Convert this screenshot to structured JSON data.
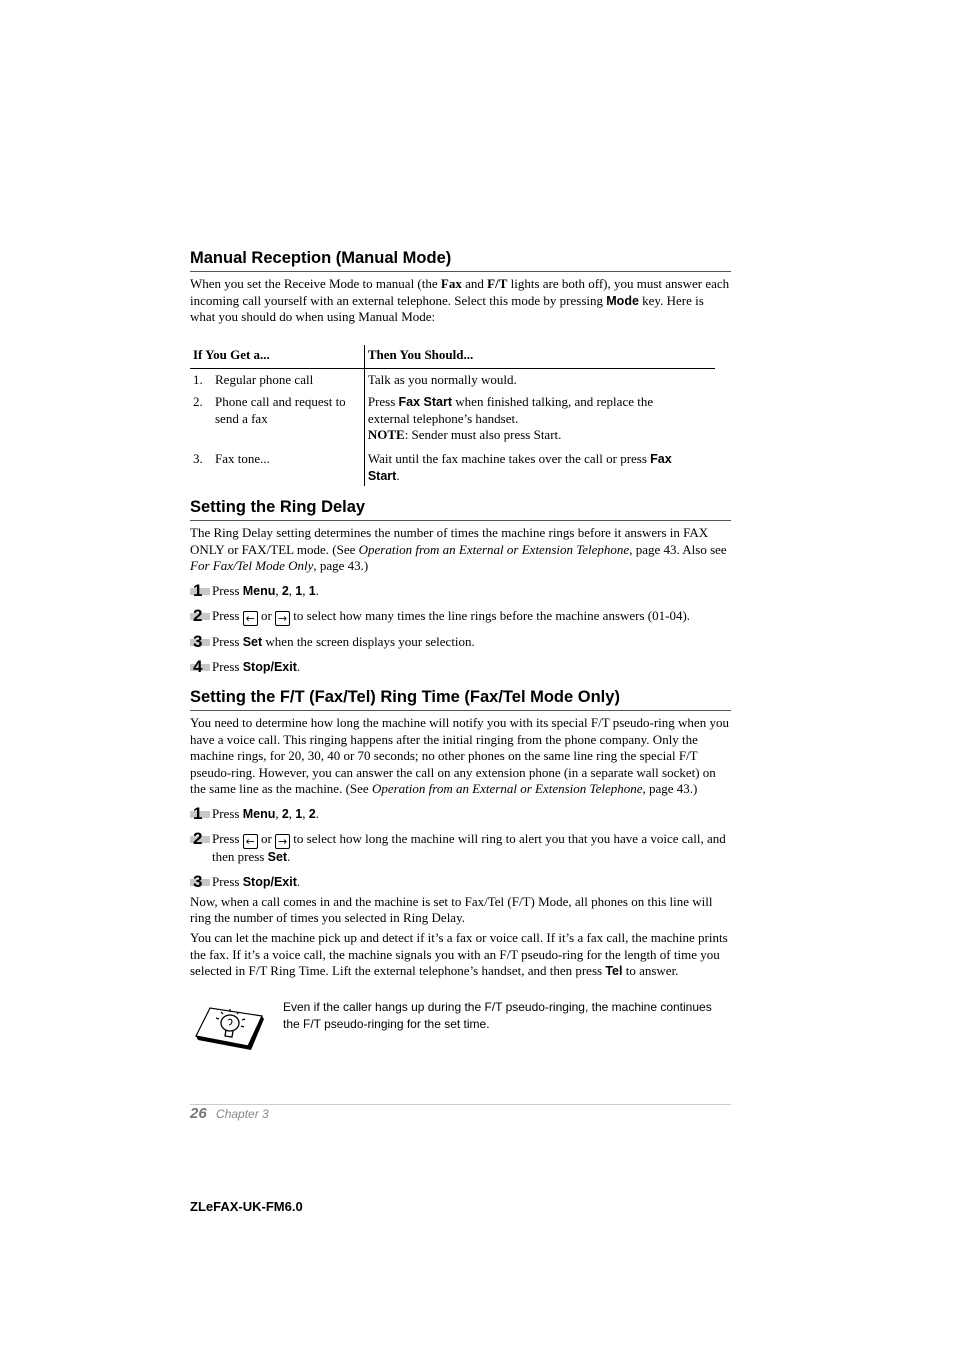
{
  "sections": {
    "manual": {
      "title": "Manual Reception (Manual Mode)",
      "intro": {
        "t1": "When you set the Receive Mode to manual (the ",
        "b1": "Fax",
        "t2": " and ",
        "b2": "F/T",
        "t3": " lights are both off), you must answer each incoming call yourself with an external telephone. Select this mode by pressing ",
        "b3": "Mode",
        "t4": " key. Here is what you should do when using Manual Mode:"
      },
      "table": {
        "headers": [
          "If You Get a...",
          "Then You Should..."
        ],
        "rows": [
          {
            "num": "1.",
            "get": "Regular phone call",
            "should": "Talk as you normally would."
          },
          {
            "num": "2.",
            "get": "Phone call and request to send a fax",
            "should_pre": "Press ",
            "should_bold": "Fax Start",
            "should_post": " when finished talking, and replace the external telephone’s handset.",
            "note_label": "NOTE",
            "note_text": ": Sender must also press Start."
          },
          {
            "num": "3.",
            "get": "Fax tone...",
            "should_pre": "Wait until the fax machine takes over the call or press ",
            "should_bold": "Fax Start",
            "should_post": "."
          }
        ]
      }
    },
    "ring_delay": {
      "title": "Setting the Ring Delay",
      "intro": {
        "t1": "The Ring Delay setting determines the number of times the machine rings before it answers in FAX ONLY or FAX/TEL mode. (See ",
        "i1": "Operation from an External or Extension Telephone",
        "t2": ", page 43. Also see ",
        "i2": "For Fax/Tel Mode Only",
        "t3": ", page 43.)"
      },
      "steps": [
        {
          "n": "1",
          "pre": "Press ",
          "b": "Menu",
          "post": ", ",
          "b2": "2",
          "sep2": ", ",
          "b3": "1",
          "sep3": ", ",
          "b4": "1",
          "end": "."
        },
        {
          "n": "2",
          "pre": "Press ",
          "mid": " or ",
          "post": " to select how many times the line rings before the machine answers (01-04)."
        },
        {
          "n": "3",
          "pre": "Press ",
          "b": "Set",
          "post": " when the screen displays your selection."
        },
        {
          "n": "4",
          "pre": "Press ",
          "b": "Stop/Exit",
          "post": "."
        }
      ]
    },
    "ft_ring": {
      "title": "Setting the F/T (Fax/Tel) Ring Time (Fax/Tel Mode Only)",
      "intro": {
        "t1": "You need to determine how long the machine will notify you with its special F/T pseudo-ring when you have a voice call. This ringing happens after the initial ringing from the phone company. Only the machine rings, for 20, 30, 40 or 70 seconds; no other phones on the same line ring the special F/T pseudo-ring. However, you can answer the call on any extension phone (in a separate wall socket) on the same line as the machine. (See ",
        "i1": "Operation from an External or Extension Telephone",
        "t2": ", page 43.)"
      },
      "steps": [
        {
          "n": "1",
          "pre": "Press ",
          "b": "Menu",
          "post": ", ",
          "b2": "2",
          "sep2": ", ",
          "b3": "1",
          "sep3": ", ",
          "b4": "2",
          "end": "."
        },
        {
          "n": "2",
          "pre": "Press ",
          "mid": " or ",
          "post": " to select how long the machine will ring to alert you that you have a voice call, and then press ",
          "b": "Set",
          "end": "."
        },
        {
          "n": "3",
          "pre": "Press ",
          "b": "Stop/Exit",
          "post": "."
        }
      ],
      "para1": "Now, when a call comes in and the machine is set to Fax/Tel (F/T) Mode, all phones on this line will ring the number of times you selected in Ring Delay.",
      "para2": {
        "t1": "You can let the machine pick up and detect if it’s a fax or voice call. If it’s a fax call, the machine prints the fax. If it’s a voice call, the machine signals you with an F/T pseudo-ring for the length of time you selected in F/T Ring Time. Lift the external telephone’s handset, and then press ",
        "b1": "Tel",
        "t2": " to answer."
      },
      "tip": "Even if the caller hangs up during the F/T pseudo-ringing, the machine continues the F/T pseudo-ringing for the set time."
    }
  },
  "icons": {
    "left_arrow": "←",
    "right_arrow": "→"
  },
  "footer": {
    "page_number": "26",
    "chapter": "Chapter 3",
    "doc_id": "ZLeFAX-UK-FM6.0"
  }
}
